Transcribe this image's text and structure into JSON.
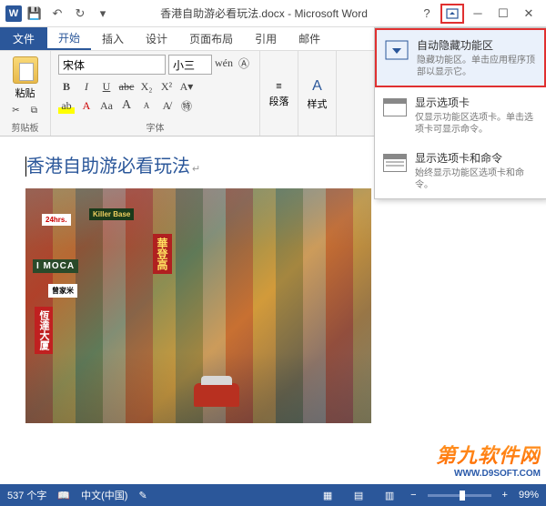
{
  "titlebar": {
    "doc_title": "香港自助游必看玩法.docx - Microsoft Word",
    "word_glyph": "W"
  },
  "tabs": {
    "file": "文件",
    "home": "开始",
    "insert": "插入",
    "design": "设计",
    "layout": "页面布局",
    "references": "引用",
    "mailings": "邮件"
  },
  "ribbon": {
    "clipboard": {
      "paste": "粘贴",
      "group_label": "剪贴板"
    },
    "font": {
      "name": "宋体",
      "size": "小三",
      "group_label": "字体",
      "wen": "wén",
      "bold": "B",
      "italic": "I",
      "underline": "U",
      "strike": "abc",
      "sub": "X₂",
      "sup": "X²",
      "grow": "A",
      "shrink": "A",
      "clear": "Aa",
      "phonetic": "A"
    },
    "paragraph": {
      "label": "段落"
    },
    "styles": {
      "label": "样式"
    }
  },
  "ribbon_menu": {
    "item1": {
      "title": "自动隐藏功能区",
      "desc": "隐藏功能区。单击应用程序顶部以显示它。"
    },
    "item2": {
      "title": "显示选项卡",
      "desc": "仅显示功能区选项卡。单击选项卡可显示命令。"
    },
    "item3": {
      "title": "显示选项卡和命令",
      "desc": "始终显示功能区选项卡和命令。"
    }
  },
  "document": {
    "heading": "香港自助游必看玩法",
    "image_signs": {
      "s1": "24hrs.",
      "s2": "Killer Base",
      "s3": "I MOCA",
      "s4": "曾家米",
      "s5": "華登高",
      "s6": "恆達大厦"
    }
  },
  "statusbar": {
    "word_count": "537 个字",
    "lang": "中文(中国)",
    "zoom": "99%",
    "minus": "−",
    "plus": "+"
  },
  "watermark": {
    "main": "第九软件网",
    "sub": "WWW.D9SOFT.COM"
  }
}
